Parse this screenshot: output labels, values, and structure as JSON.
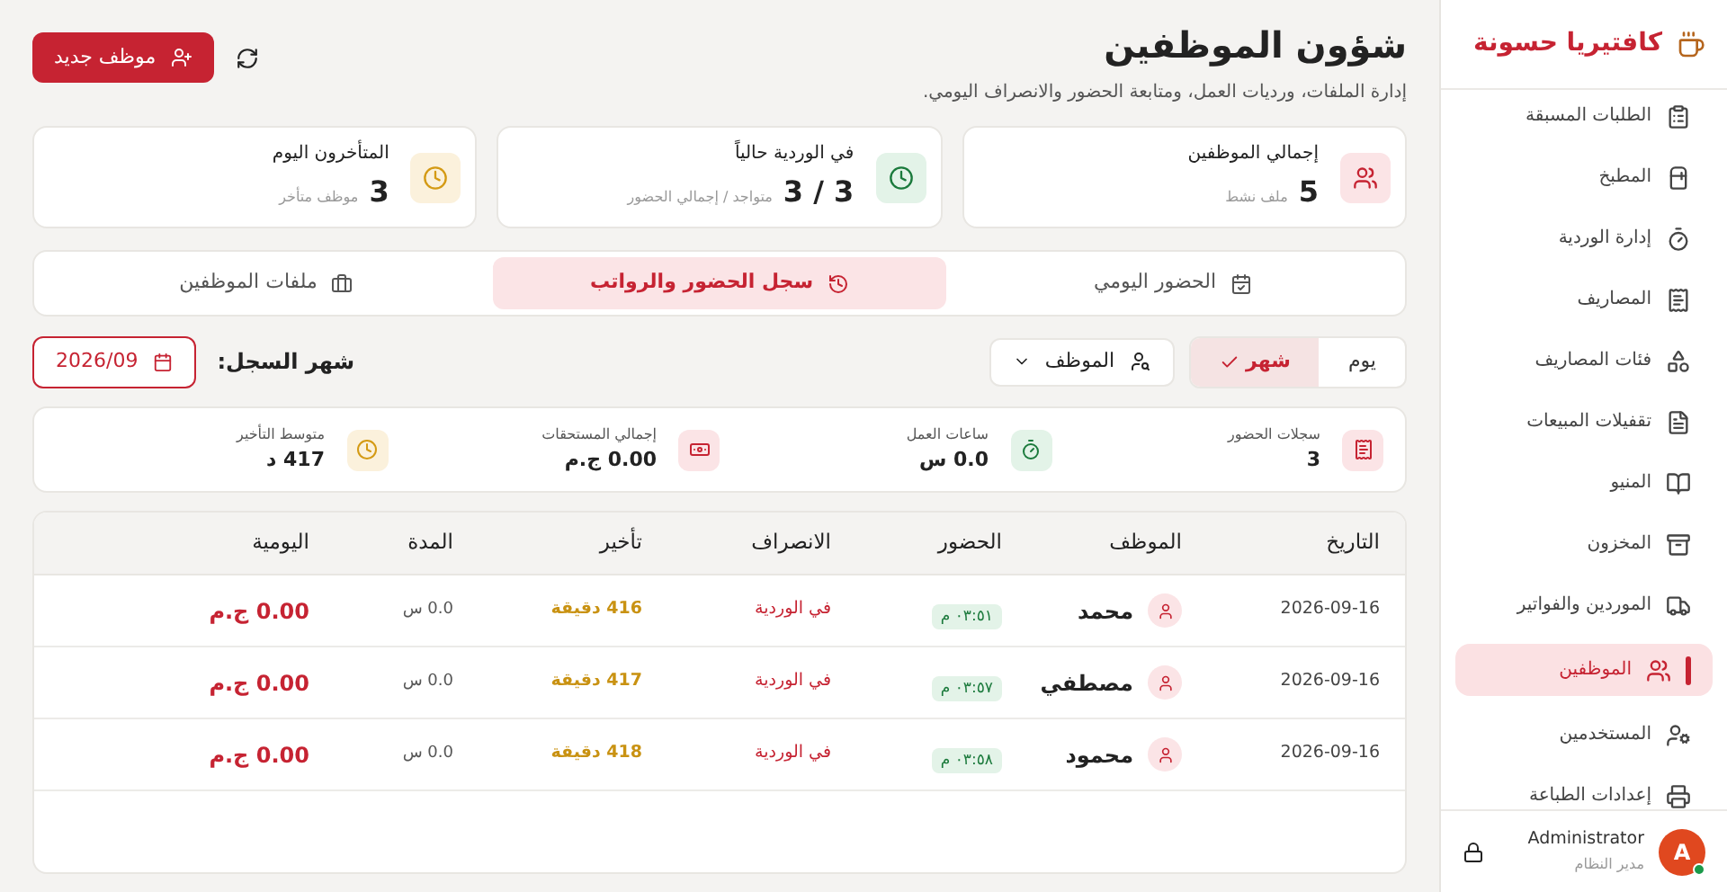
{
  "sidebar": {
    "brand": "كافتيريا حسونة",
    "items": [
      {
        "label": "الطلبات المسبقة",
        "selected": false
      },
      {
        "label": "المطبخ",
        "selected": false
      },
      {
        "label": "إدارة الوردية",
        "selected": false
      },
      {
        "label": "المصاريف",
        "selected": false
      },
      {
        "label": "فئات المصاريف",
        "selected": false
      },
      {
        "label": "تقفيلات المبيعات",
        "selected": false
      },
      {
        "label": "المنيو",
        "selected": false
      },
      {
        "label": "المخزون",
        "selected": false
      },
      {
        "label": "الموردين والفواتير",
        "selected": false
      },
      {
        "label": "الموظفين",
        "selected": true
      },
      {
        "label": "المستخدمين",
        "selected": false
      },
      {
        "label": "إعدادات الطباعة",
        "selected": false
      }
    ],
    "user": {
      "initial": "A",
      "name": "Administrator",
      "role": "مدير النظام",
      "online": true
    }
  },
  "header": {
    "title": "شؤون الموظفين",
    "subtitle": "إدارة الملفات، ورديات العمل، ومتابعة الحضور والانصراف اليومي.",
    "new_button": "موظف جديد"
  },
  "stats": [
    {
      "kind": "people",
      "label": "إجمالي الموظفين",
      "value": "5",
      "note": "ملف نشط"
    },
    {
      "kind": "present",
      "label": "في الوردية حالياً",
      "value": "3 / 3",
      "note": "متواجد / إجمالي الحضور"
    },
    {
      "kind": "late",
      "label": "المتأخرون اليوم",
      "value": "3",
      "note": "موظف متأخر"
    }
  ],
  "tabs": [
    {
      "label": "الحضور اليومي",
      "selected": false
    },
    {
      "label": "سجل الحضور والرواتب",
      "selected": true
    },
    {
      "label": "ملفات الموظفين",
      "selected": false
    }
  ],
  "view_toggle": [
    {
      "label": "يوم",
      "selected": false
    },
    {
      "label": "شهر",
      "selected": true
    }
  ],
  "employee_filter": {
    "label": "الموظف"
  },
  "month": {
    "label": "شهر السجل:",
    "value": "2026/09"
  },
  "summary": [
    {
      "kind": "records",
      "label": "سجلات الحضور",
      "value": "3"
    },
    {
      "kind": "hours",
      "label": "ساعات العمل",
      "value": "0.0 س"
    },
    {
      "kind": "money",
      "label": "إجمالي المستحقات",
      "value": "0.00 ج.م"
    },
    {
      "kind": "late",
      "label": "متوسط التأخير",
      "value": "417 د"
    }
  ],
  "table": {
    "columns": [
      "التاريخ",
      "الموظف",
      "الحضور",
      "الانصراف",
      "تأخير",
      "المدة",
      "اليومية"
    ],
    "rows": [
      {
        "date": "2026-09-16",
        "employee": "محمد",
        "check_in": "٠٣:٥١ م",
        "check_out": "في الوردية",
        "late": "416 دقيقة",
        "duration": "0.0 س",
        "daily": "0.00 ج.م"
      },
      {
        "date": "2026-09-16",
        "employee": "مصطفي",
        "check_in": "٠٣:٥٧ م",
        "check_out": "في الوردية",
        "late": "417 دقيقة",
        "duration": "0.0 س",
        "daily": "0.00 ج.م"
      },
      {
        "date": "2026-09-16",
        "employee": "محمود",
        "check_in": "٠٣:٥٨ م",
        "check_out": "في الوردية",
        "late": "418 دقيقة",
        "duration": "0.0 س",
        "daily": "0.00 ج.م"
      }
    ]
  }
}
